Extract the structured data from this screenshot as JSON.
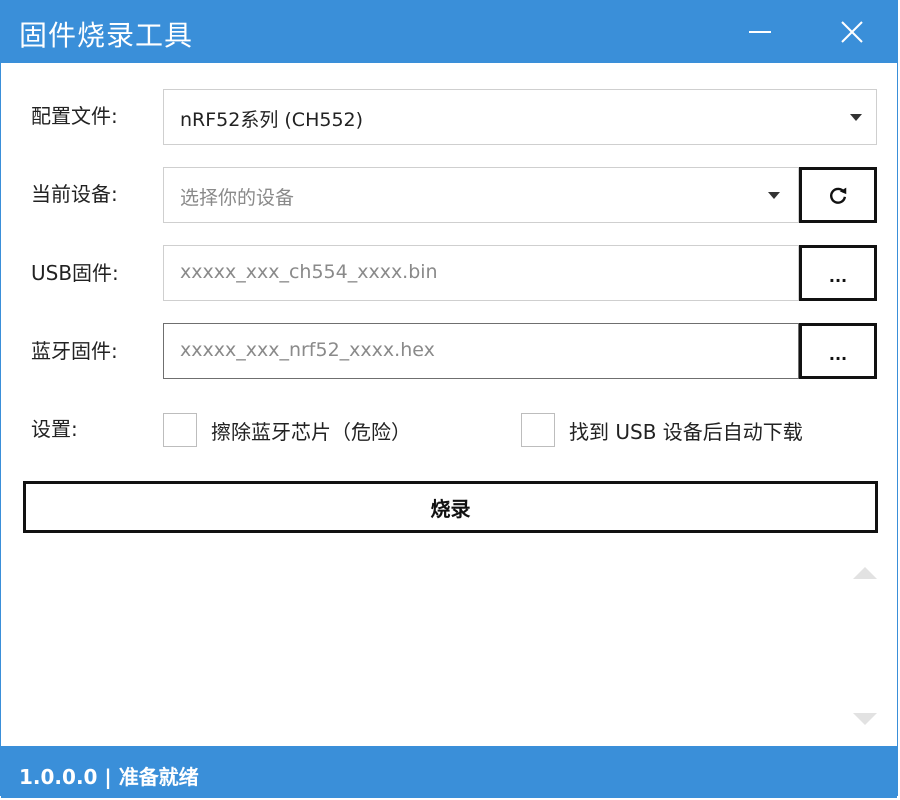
{
  "window": {
    "title": "固件烧录工具"
  },
  "config": {
    "label": "配置文件:",
    "value": "nRF52系列 (CH552)"
  },
  "device": {
    "label": "当前设备:",
    "placeholder": "选择你的设备",
    "refresh_icon": "refresh-icon"
  },
  "usb_firmware": {
    "label": "USB固件:",
    "placeholder": "xxxxx_xxx_ch554_xxxx.bin",
    "browse_label": "..."
  },
  "ble_firmware": {
    "label": "蓝牙固件:",
    "placeholder": "xxxxx_xxx_nrf52_xxxx.hex",
    "browse_label": "..."
  },
  "settings": {
    "label": "设置:",
    "erase_chip": {
      "label": "擦除蓝牙芯片（危险）",
      "checked": false
    },
    "auto_download": {
      "label": "找到 USB 设备后自动下载",
      "checked": false
    }
  },
  "burn_button": {
    "label": "烧录"
  },
  "status": {
    "text": "1.0.0.0 | 准备就绪"
  },
  "colors": {
    "accent": "#3a8fd9",
    "button_border": "#111111"
  }
}
